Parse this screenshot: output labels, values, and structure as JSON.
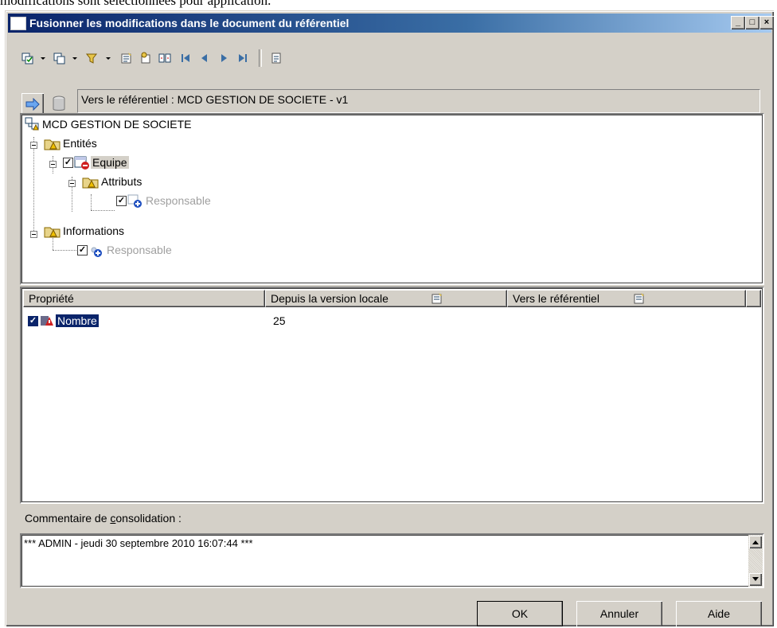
{
  "top_caption": "modifications sont sélectionnées pour application.",
  "window": {
    "title": "Fusionner les modifications dans le document du référentiel",
    "controls": {
      "minimize": "_",
      "maximize": "□",
      "close": "×"
    }
  },
  "toolbar": {
    "icons": [
      "select-all-icon",
      "deselect-icon",
      "filter-icon",
      "properties-icon",
      "find-icon",
      "compare-icon",
      "first-icon",
      "previous-icon",
      "next-icon",
      "last-icon",
      "report-icon"
    ]
  },
  "target": {
    "label": "Vers le référentiel : MCD GESTION DE SOCIETE - v1"
  },
  "tree": {
    "root": "MCD GESTION DE SOCIETE",
    "entities": "Entités",
    "equipe": "Equipe",
    "attributs": "Attributs",
    "responsable_attr": "Responsable",
    "informations": "Informations",
    "responsable_info": "Responsable"
  },
  "properties": {
    "columns": [
      "Propriété",
      "Depuis la version locale",
      "Vers le référentiel"
    ],
    "rows": [
      {
        "property": "Nombre",
        "local": "25",
        "repository": ""
      }
    ]
  },
  "comment": {
    "label_before": "Commentaire de ",
    "label_accel": "c",
    "label_after": "onsolidation :",
    "value": "*** ADMIN - jeudi 30 septembre 2010 16:07:44 ***"
  },
  "buttons": {
    "ok": "OK",
    "cancel": "Annuler",
    "help": "Aide"
  },
  "colors": {
    "titlebar": "#0a246a",
    "face": "#d4d0c8",
    "selection": "#0a246a"
  }
}
